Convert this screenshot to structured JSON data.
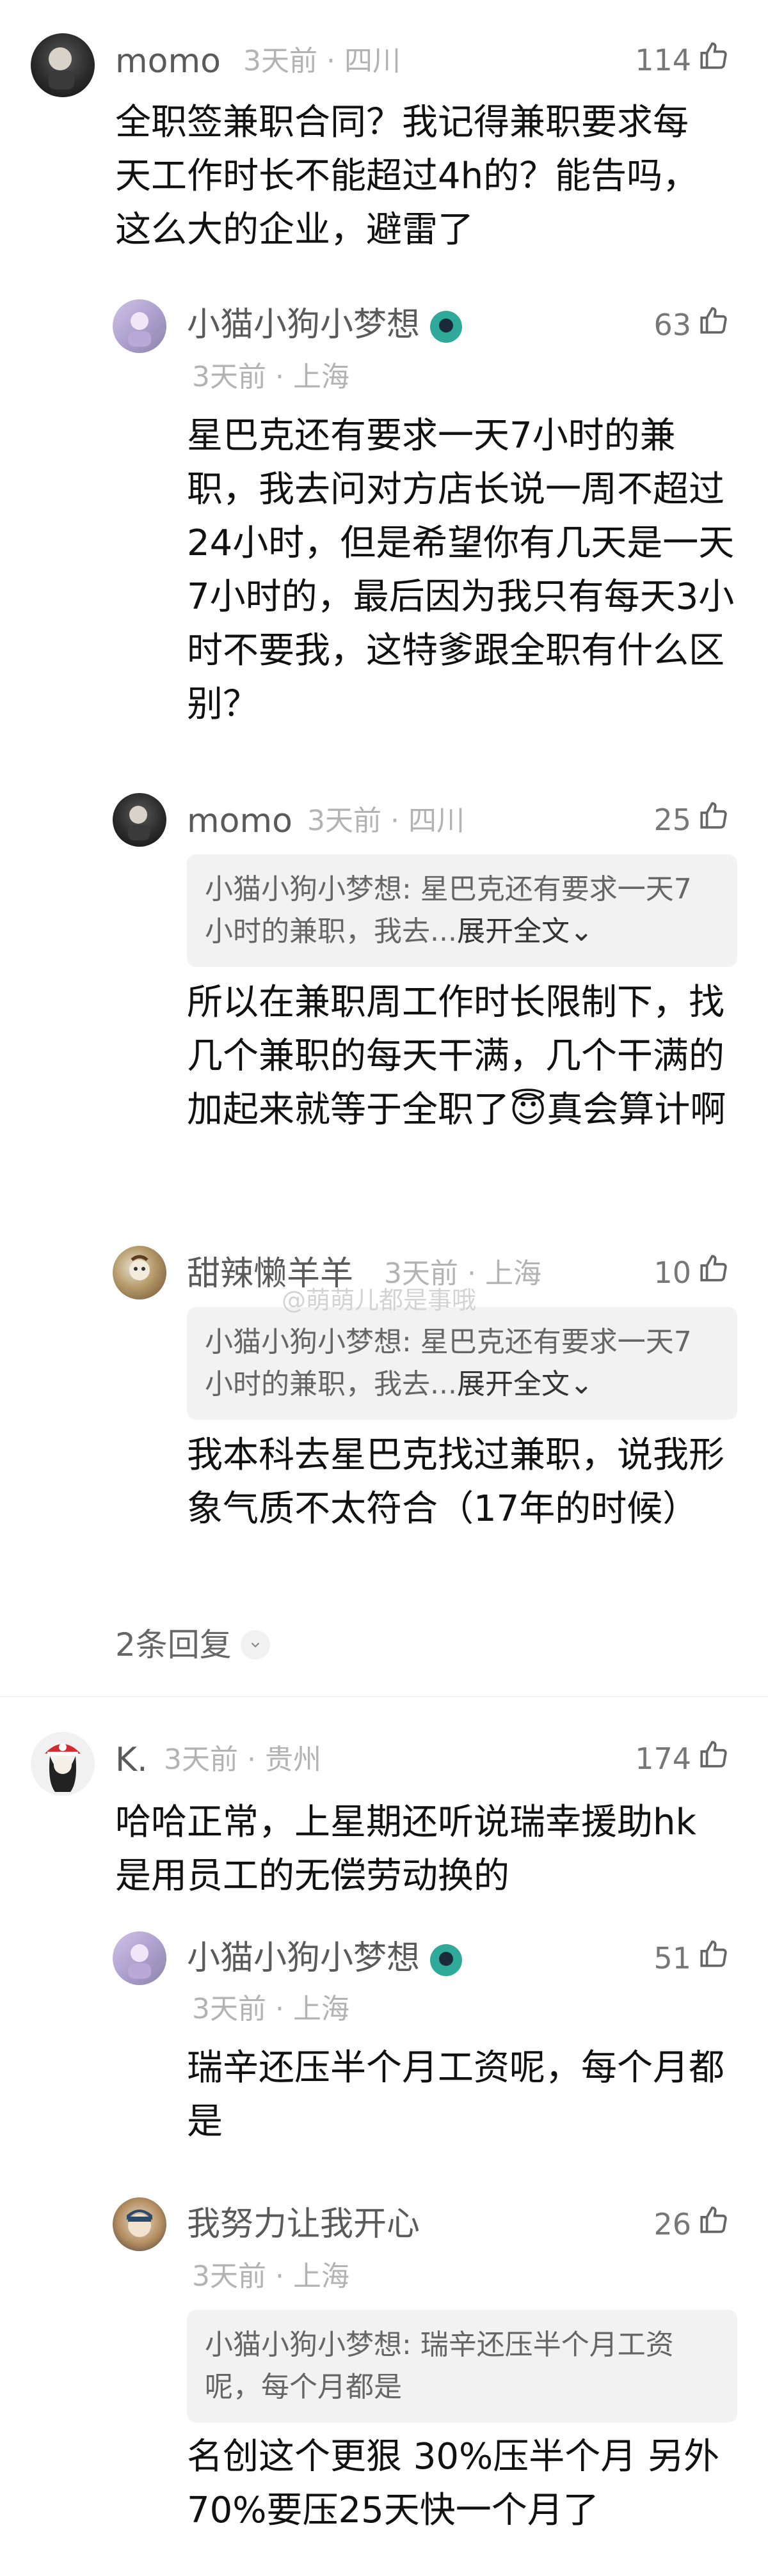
{
  "comments": [
    {
      "user": "momo",
      "time": "3天前",
      "location": "四川",
      "likes": "114",
      "text": "全职签兼职合同？我记得兼职要求每天工作时长不能超过4h的？能告吗，这么大的企业，避雷了",
      "replies": [
        {
          "user": "小猫小狗小梦想",
          "time": "3天前",
          "location": "上海",
          "likes": "63",
          "text": "星巴克还有要求一天7小时的兼职，我去问对方店长说一周不超过24小时，但是希望你有几天是一天7小时的，最后因为我只有每天3小时不要我，这特爹跟全职有什么区别？"
        },
        {
          "user": "momo",
          "time": "3天前",
          "location": "四川",
          "likes": "25",
          "quote": "小猫小狗小梦想: 星巴克还有要求一天7小时的兼职，我去...",
          "quote_expand": "展开全文",
          "text": "所以在兼职周工作时长限制下，找几个兼职的每天干满，几个干满的加起来就等于全职了😇真会算计啊"
        },
        {
          "user": "甜辣懒羊羊",
          "time": "3天前",
          "location": "上海",
          "likes": "10",
          "quote": "小猫小狗小梦想: 星巴克还有要求一天7小时的兼职，我去...",
          "quote_expand": "展开全文",
          "text": "我本科去星巴克找过兼职，说我形象气质不太符合（17年的时候）"
        }
      ],
      "more_replies": "2条回复"
    },
    {
      "user": "K.",
      "time": "3天前",
      "location": "贵州",
      "likes": "174",
      "text": "哈哈正常，上星期还听说瑞幸援助hk是用员工的无偿劳动换的",
      "replies": [
        {
          "user": "小猫小狗小梦想",
          "time": "3天前",
          "location": "上海",
          "likes": "51",
          "text": "瑞辛还压半个月工资呢，每个月都是"
        },
        {
          "user": "我努力让我开心",
          "time": "3天前",
          "location": "上海",
          "likes": "26",
          "quote": "小猫小狗小梦想: 瑞辛还压半个月工资呢，每个月都是",
          "text": "名创这个更狠  30%压半个月  另外70%要压25天快一个月了"
        }
      ]
    }
  ],
  "watermark": "@萌萌儿都是事哦",
  "icons": {
    "like": "thumbs-up-icon",
    "badge": "member-badge-icon",
    "chevron": "chevron-down-icon"
  },
  "colors": {
    "username": "#5a5a5a",
    "meta": "#b3b3b3",
    "quote_bg": "#f2f2f2",
    "badge": "#2fa99a"
  }
}
